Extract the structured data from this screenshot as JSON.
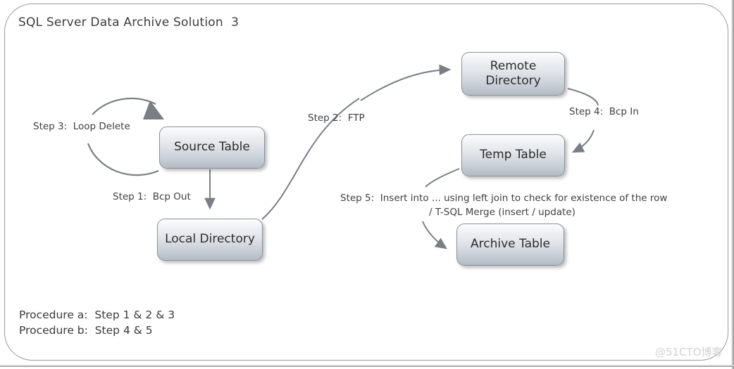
{
  "diagram": {
    "title": "SQL Server Data Archive Solution  3",
    "nodes": [
      {
        "id": "source-table",
        "label": "Source Table"
      },
      {
        "id": "local-dir",
        "label": "Local Directory"
      },
      {
        "id": "remote-dir",
        "label": "Remote\nDirectory"
      },
      {
        "id": "temp-table",
        "label": "Temp Table"
      },
      {
        "id": "archive-table",
        "label": "Archive Table"
      }
    ],
    "labels": {
      "step3": "Step 3:  Loop Delete",
      "step1": "Step 1:  Bcp Out",
      "step2": "Step 2:  FTP",
      "step4": "Step 4:  Bcp In",
      "step5": "Step 5:  Insert into ... using left join to check for existence of the row\n/ T-SQL Merge (insert / update)"
    },
    "footer": {
      "procedure_a": "Procedure a:  Step 1 & 2 & 3",
      "procedure_b": "Procedure b:  Step 4 & 5"
    },
    "watermark": "@51CTO博客",
    "colors": {
      "frame_border": "#9a9a9a",
      "node_border": "#8c919a",
      "node_gradient_top": "#fdfdfe",
      "node_gradient_bottom": "#b4bbc4",
      "connector": "#7a7f85",
      "text": "#3a3a3a",
      "background": "#ffffff"
    }
  }
}
